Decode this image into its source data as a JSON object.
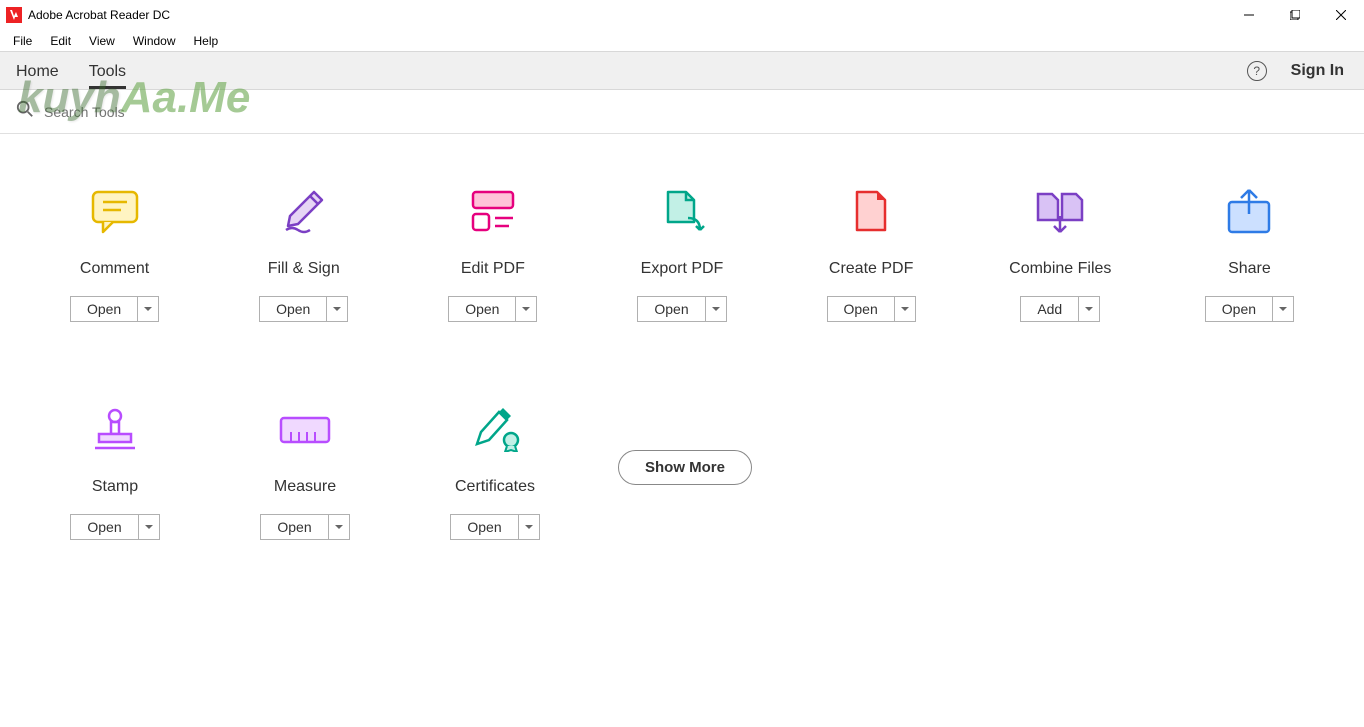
{
  "window": {
    "title": "Adobe Acrobat Reader DC"
  },
  "menu": [
    "File",
    "Edit",
    "View",
    "Window",
    "Help"
  ],
  "tabs": {
    "home": "Home",
    "tools": "Tools"
  },
  "signin": "Sign In",
  "search": {
    "placeholder": "Search Tools"
  },
  "watermark": {
    "a": "kuyh",
    "b": "Aa.Me"
  },
  "tools": [
    {
      "name": "Comment",
      "action": "Open"
    },
    {
      "name": "Fill & Sign",
      "action": "Open"
    },
    {
      "name": "Edit PDF",
      "action": "Open"
    },
    {
      "name": "Export PDF",
      "action": "Open"
    },
    {
      "name": "Create PDF",
      "action": "Open"
    },
    {
      "name": "Combine Files",
      "action": "Add"
    },
    {
      "name": "Share",
      "action": "Open"
    },
    {
      "name": "Stamp",
      "action": "Open"
    },
    {
      "name": "Measure",
      "action": "Open"
    },
    {
      "name": "Certificates",
      "action": "Open"
    }
  ],
  "show_more": "Show More"
}
